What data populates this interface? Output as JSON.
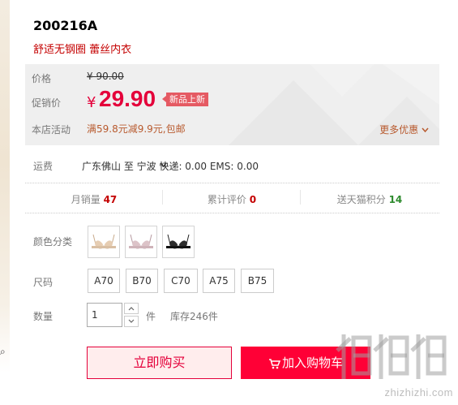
{
  "product": {
    "code": "200216A",
    "subtitle": "舒适无钢圈 蕾丝内衣"
  },
  "pricing": {
    "price_label": "价格",
    "original_price": "¥ 90.00",
    "promo_label": "促销价",
    "currency": "¥",
    "promo_price": "29.90",
    "new_tag": "新品上新",
    "activity_label": "本店活动",
    "activity_text": "满59.8元减9.9元,包邮",
    "more_offers": "更多优惠"
  },
  "shipping": {
    "label": "运费",
    "text": "广东佛山  至 宁波  快递: 0.00 EMS: 0.00"
  },
  "stats": {
    "monthly_sales_label": "月销量",
    "monthly_sales": "47",
    "reviews_label": "累计评价",
    "reviews": "0",
    "points_label": "送天猫积分",
    "points": "14"
  },
  "options": {
    "color_label": "颜色分类",
    "colors": [
      "nude-bra",
      "pink-bra",
      "black-bra"
    ],
    "size_label": "尺码",
    "sizes": [
      "A70",
      "B70",
      "C70",
      "A75",
      "B75"
    ],
    "qty_label": "数量",
    "qty_value": "1",
    "qty_unit": "件",
    "stock": "库存246件"
  },
  "actions": {
    "buy_now": "立即购买",
    "add_to_cart": "加入购物车"
  },
  "watermark": {
    "text": "zhizhizhi.com"
  },
  "colors": {
    "accent_red": "#e4003a",
    "cart_red": "#ff0036",
    "price_bg": "#efefef",
    "activity_brown": "#b85a2e"
  }
}
